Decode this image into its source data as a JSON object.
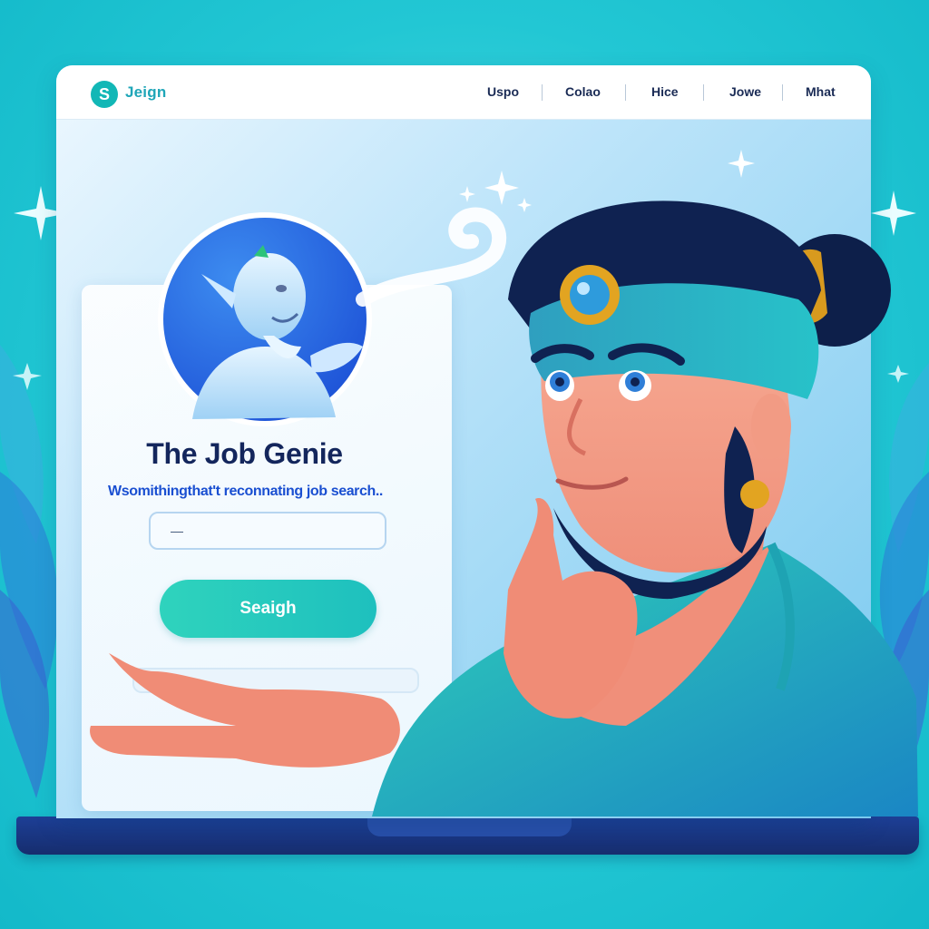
{
  "app": {
    "logo_icon": "S",
    "logo_text": "Jeign"
  },
  "nav": {
    "items": [
      {
        "label": "Uspo"
      },
      {
        "label": "Colao"
      },
      {
        "label": "Hice"
      },
      {
        "label": "Jowe"
      },
      {
        "label": "Mhat"
      }
    ]
  },
  "hero": {
    "title": "The Job Genie",
    "subtitle": "Wsomithingthat't reconnating job search..",
    "search_value": "—",
    "search_button": "Seaigh"
  },
  "colors": {
    "accent": "#1ec0be",
    "title": "#13265c",
    "subtitle": "#1a4fd1",
    "background": "#22c7d4"
  },
  "icons": [
    "logo-icon",
    "genie-avatar",
    "sparkle-icon",
    "genie-character"
  ]
}
